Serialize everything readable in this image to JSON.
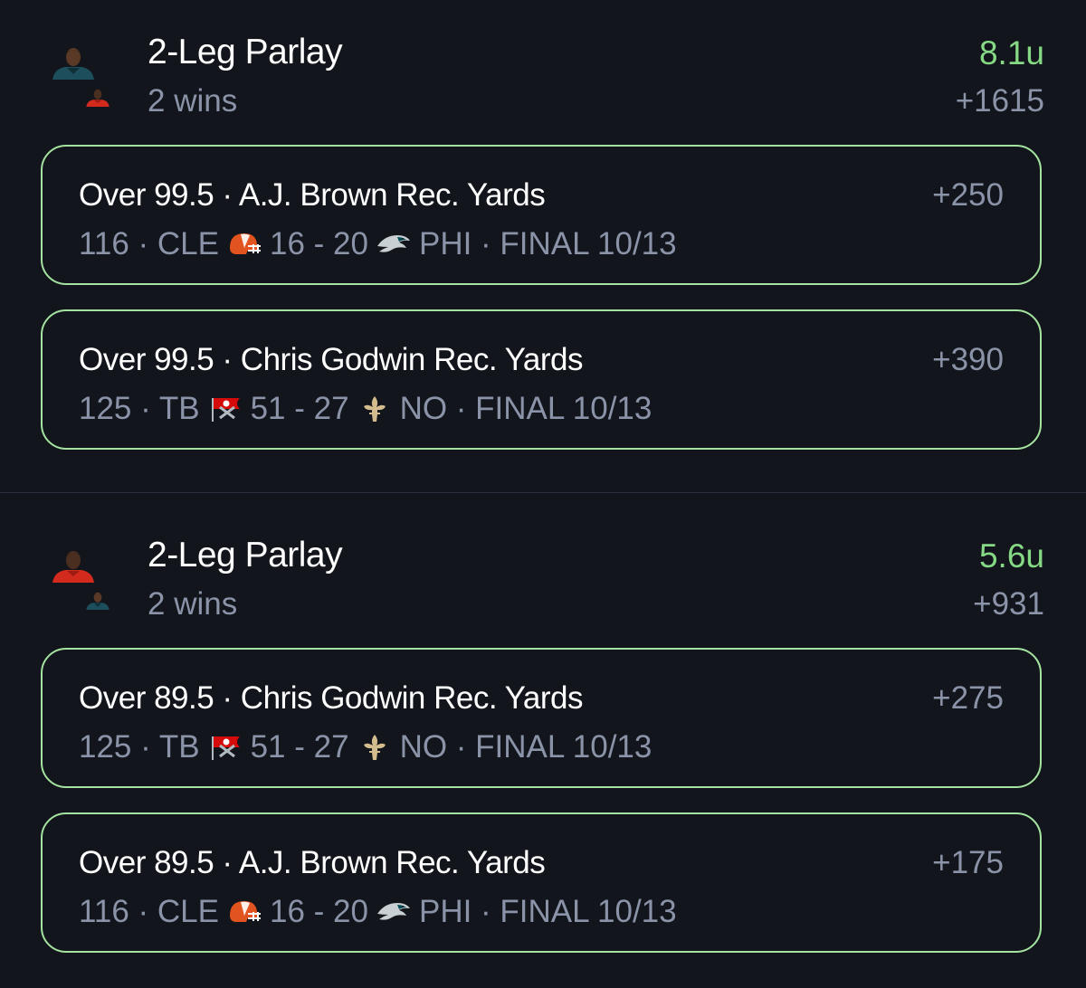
{
  "colors": {
    "background": "#12151b",
    "win_units": "#86d985",
    "card_border": "#a4e2a0",
    "muted_text": "#8a93a8",
    "divider": "#2a3240"
  },
  "parlays": [
    {
      "title": "2-Leg Parlay",
      "subtitle": "2 wins",
      "units": "8.1u",
      "odds": "+1615",
      "legs": [
        {
          "title": "Over 99.5 · A.J. Brown Rec. Yards",
          "odds": "+250",
          "stat_and_team": "116 · CLE",
          "away_logo_icon": "browns-helmet-icon",
          "score": "16 - 20",
          "home_logo_icon": "eagles-icon",
          "result": "PHI · FINAL 10/13"
        },
        {
          "title": "Over 99.5 · Chris Godwin Rec. Yards",
          "odds": "+390",
          "stat_and_team": "125 · TB",
          "away_logo_icon": "buccaneers-flag-icon",
          "score": "51 - 27",
          "home_logo_icon": "saints-fleur-de-lis-icon",
          "result": "NO · FINAL 10/13"
        }
      ]
    },
    {
      "title": "2-Leg Parlay",
      "subtitle": "2 wins",
      "units": "5.6u",
      "odds": "+931",
      "legs": [
        {
          "title": "Over 89.5 · Chris Godwin Rec. Yards",
          "odds": "+275",
          "stat_and_team": "125 · TB",
          "away_logo_icon": "buccaneers-flag-icon",
          "score": "51 - 27",
          "home_logo_icon": "saints-fleur-de-lis-icon",
          "result": "NO · FINAL 10/13"
        },
        {
          "title": "Over 89.5 · A.J. Brown Rec. Yards",
          "odds": "+175",
          "stat_and_team": "116 · CLE",
          "away_logo_icon": "browns-helmet-icon",
          "score": "16 - 20",
          "home_logo_icon": "eagles-icon",
          "result": "PHI · FINAL 10/13"
        }
      ]
    }
  ]
}
